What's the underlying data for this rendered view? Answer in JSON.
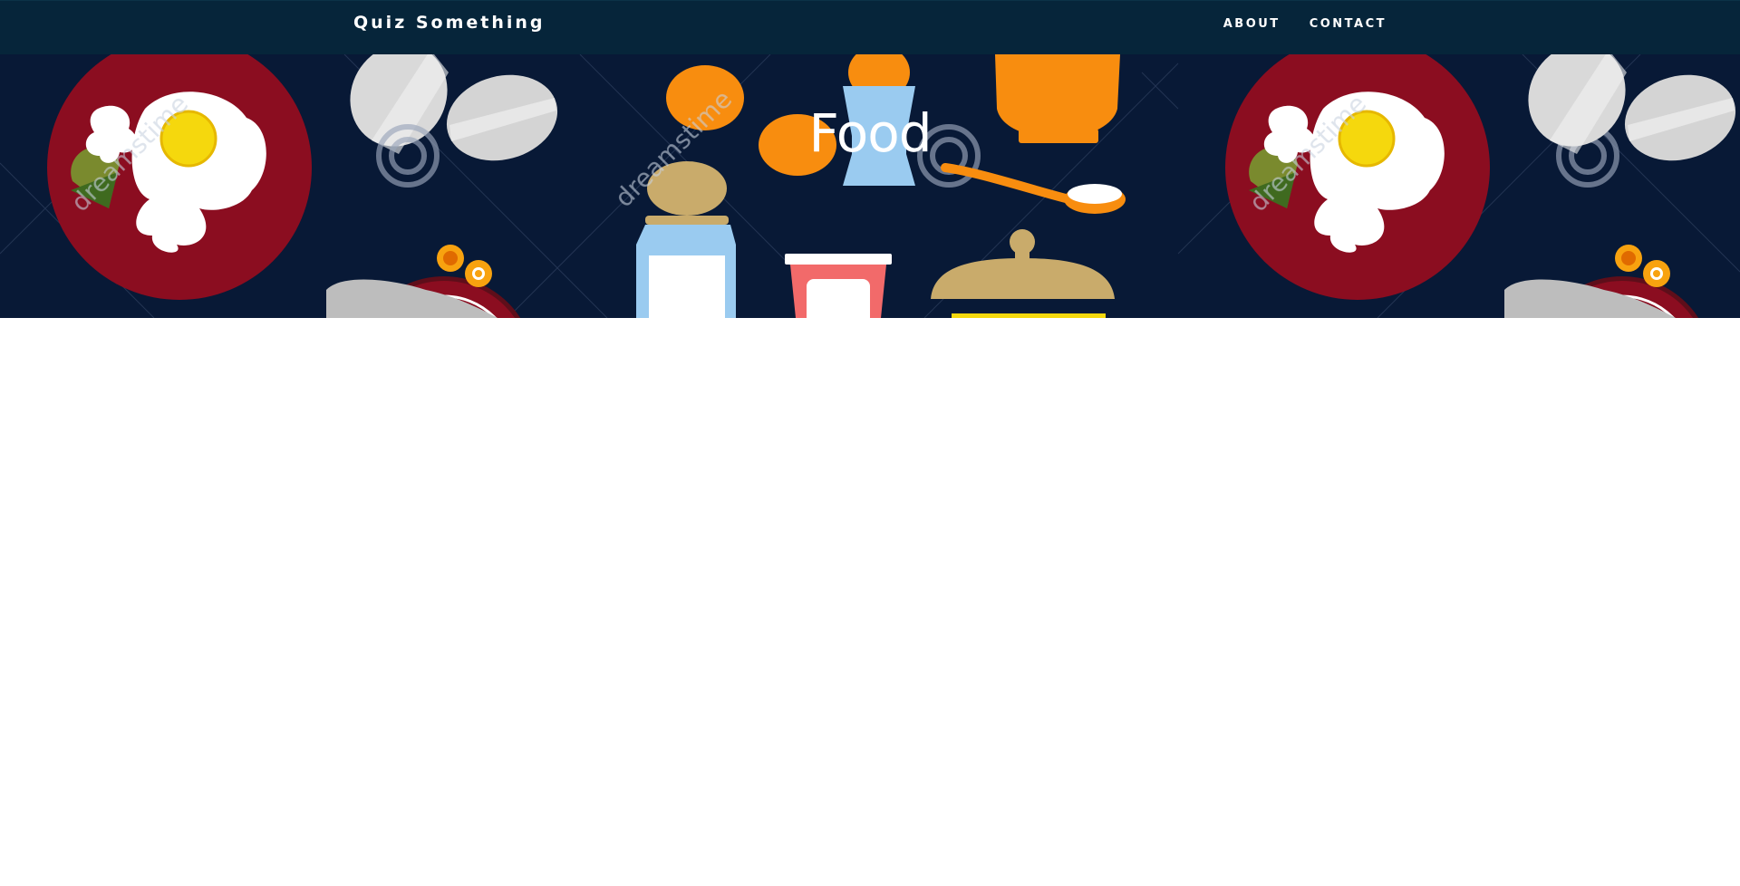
{
  "navbar": {
    "brand": "Quiz Something",
    "links": [
      {
        "label": "ABOUT"
      },
      {
        "label": "CONTACT"
      }
    ]
  },
  "hero": {
    "title": "Food",
    "watermark_text": "dreamstime"
  },
  "colors": {
    "navbar_bg": "#06253a",
    "hero_bg": "#081936",
    "plate_red": "#8b0d20",
    "egg_white": "#ffffff",
    "yolk": "#f5d80d",
    "orange": "#f88d0f",
    "bottle_blue": "#9acbf0",
    "tan": "#c9ab6b",
    "yogurt_red": "#f26a6a"
  }
}
